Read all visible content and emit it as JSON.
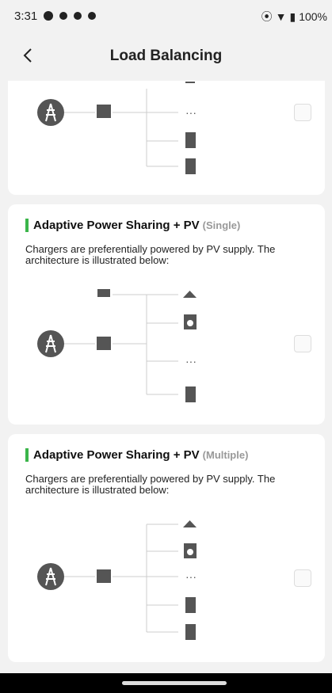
{
  "status": {
    "time": "3:31",
    "battery": "100%"
  },
  "header": {
    "title": "Load Balancing"
  },
  "cards": [
    {
      "title": "",
      "subtitle": "",
      "description": ""
    },
    {
      "title": "Adaptive Power Sharing + PV",
      "subtitle": "(Single)",
      "description": "Chargers are preferentially powered by PV supply. The architecture is illustrated below:"
    },
    {
      "title": "Adaptive Power Sharing + PV",
      "subtitle": "(Multiple)",
      "description": "Chargers are preferentially powered by PV supply. The architecture is illustrated below:"
    }
  ],
  "icons": {
    "grid": "power-tower-icon",
    "meter": "meter-icon",
    "charger": "charger-icon",
    "solar": "solar-panel-icon",
    "lamp": "lamp-icon",
    "washer": "washing-machine-icon",
    "more": "more-icon",
    "chevron": "chevron-right-icon"
  },
  "ellipsis": "···",
  "colors": {
    "accent": "#3bb54a",
    "icon": "#555555"
  }
}
